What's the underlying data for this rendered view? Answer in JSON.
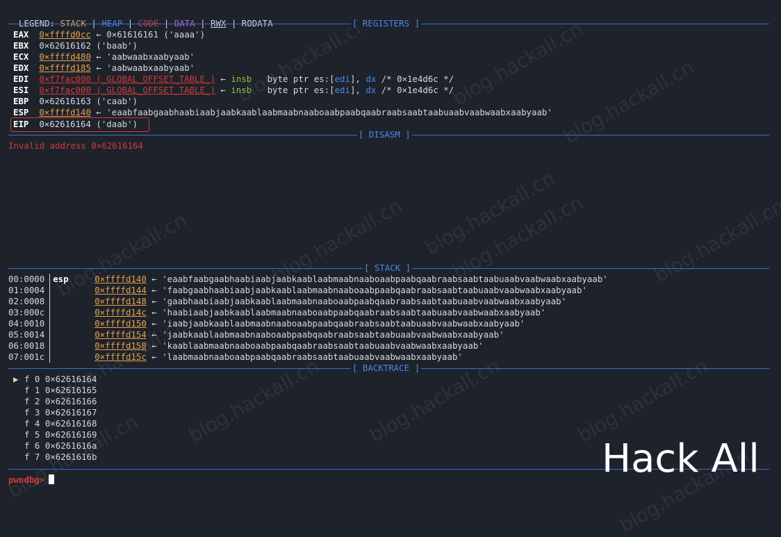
{
  "legend": {
    "prefix": "LEGEND: ",
    "items": [
      {
        "label": "STACK",
        "color": "#e6a24a"
      },
      {
        "label": "HEAP",
        "color": "#4a8ae8"
      },
      {
        "label": "CODE",
        "color": "#d23b3b"
      },
      {
        "label": "DATA",
        "color": "#b266d6"
      },
      {
        "label": "RWX"
      },
      {
        "label": "RODATA"
      }
    ],
    "separator": " | "
  },
  "sections": {
    "registers": "[ REGISTERS ]",
    "disasm": "[ DISASM ]",
    "stack": "[ STACK ]",
    "backtrace": "[ BACKTRACE ]"
  },
  "registers": [
    {
      "name": "EAX",
      "addr": "0×ffffd0cc",
      "rest": " ← 0×61616161 ('aaaa')"
    },
    {
      "name": "EBX",
      "plain": "0×62616162 ('baab')"
    },
    {
      "name": "ECX",
      "addr": "0×ffffd480",
      "rest": " ← 'aabwaabxaabyaab'"
    },
    {
      "name": "EDX",
      "addr": "0×ffffd185",
      "rest": " ← 'aabwaabxaabyaab'"
    },
    {
      "name": "EDI",
      "code": "0×f7fac000 (_GLOBAL_OFFSET_TABLE_)",
      "arrow": " ← ",
      "ins": "insb",
      "op1": "byte ptr es:[",
      "r1": "edi",
      "op2": "], ",
      "r2": "dx",
      "cmt": " /* 0×1e4d6c */"
    },
    {
      "name": "ESI",
      "code": "0×f7fac000 (_GLOBAL_OFFSET_TABLE_)",
      "arrow": " ← ",
      "ins": "insb",
      "op1": "byte ptr es:[",
      "r1": "edi",
      "op2": "], ",
      "r2": "dx",
      "cmt": " /* 0×1e4d6c */"
    },
    {
      "name": "EBP",
      "plain": "0×62616163 ('caab')"
    },
    {
      "name": "ESP",
      "addr": "0×ffffd140",
      "rest": " ← 'eaabfaabgaabhaabiaabjaabkaablaabmaabnaaboaabpaabqaabraabsaabtaabuaabvaabwaabxaabyaab'"
    },
    {
      "name": "EIP",
      "plain": "0×62616164 ('daab')"
    }
  ],
  "disasm": {
    "error": "Invalid address 0×62616164"
  },
  "stack": [
    {
      "offset": "00:0000",
      "reg": "esp",
      "addr": "0×ffffd140",
      "value": " ← 'eaabfaabgaabhaabiaabjaabkaablaabmaabnaaboaabpaabqaabraabsaabtaabuaabvaabwaabxaabyaab'"
    },
    {
      "offset": "01:0004",
      "reg": "",
      "addr": "0×ffffd144",
      "value": " ← 'faabgaabhaabiaabjaabkaablaabmaabnaaboaabpaabqaabraabsaabtaabuaabvaabwaabxaabyaab'"
    },
    {
      "offset": "02:0008",
      "reg": "",
      "addr": "0×ffffd148",
      "value": " ← 'gaabhaabiaabjaabkaablaabmaabnaaboaabpaabqaabraabsaabtaabuaabvaabwaabxaabyaab'"
    },
    {
      "offset": "03:000c",
      "reg": "",
      "addr": "0×ffffd14c",
      "value": " ← 'haabiaabjaabkaablaabmaabnaaboaabpaabqaabraabsaabtaabuaabvaabwaabxaabyaab'"
    },
    {
      "offset": "04:0010",
      "reg": "",
      "addr": "0×ffffd150",
      "value": " ← 'iaabjaabkaablaabmaabnaaboaabpaabqaabraabsaabtaabuaabvaabwaabxaabyaab'"
    },
    {
      "offset": "05:0014",
      "reg": "",
      "addr": "0×ffffd154",
      "value": " ← 'jaabkaablaabmaabnaaboaabpaabqaabraabsaabtaabuaabvaabwaabxaabyaab'"
    },
    {
      "offset": "06:0018",
      "reg": "",
      "addr": "0×ffffd158",
      "value": " ← 'kaablaabmaabnaaboaabpaabqaabraabsaabtaabuaabvaabwaabxaabyaab'"
    },
    {
      "offset": "07:001c",
      "reg": "",
      "addr": "0×ffffd15c",
      "value": " ← 'laabmaabnaaboaabpaabqaabraabsaabtaabuaabvaabwaabxaabyaab'"
    }
  ],
  "backtrace": [
    {
      "marker": "▶",
      "frame": "f 0",
      "addr": "0×62616164"
    },
    {
      "marker": "",
      "frame": "f 1",
      "addr": "0×62616165"
    },
    {
      "marker": "",
      "frame": "f 2",
      "addr": "0×62616166"
    },
    {
      "marker": "",
      "frame": "f 3",
      "addr": "0×62616167"
    },
    {
      "marker": "",
      "frame": "f 4",
      "addr": "0×62616168"
    },
    {
      "marker": "",
      "frame": "f 5",
      "addr": "0×62616169"
    },
    {
      "marker": "",
      "frame": "f 6",
      "addr": "0×6261616a"
    },
    {
      "marker": "",
      "frame": "f 7",
      "addr": "0×6261616b"
    }
  ],
  "prompt": "pwndbg>",
  "watermark": "blog.hackall.cn",
  "brand": "Hack All"
}
